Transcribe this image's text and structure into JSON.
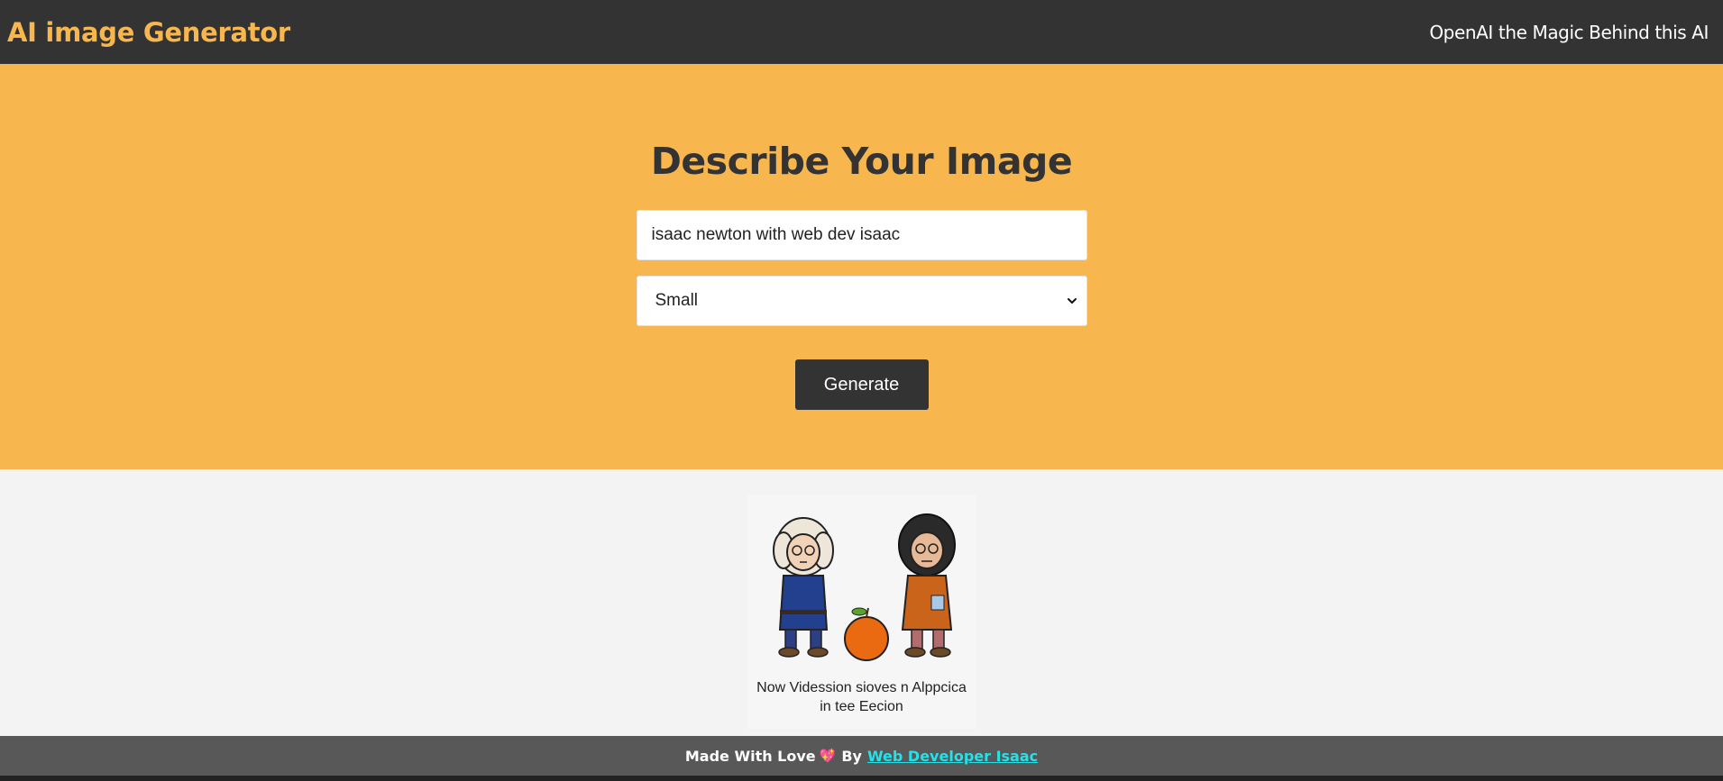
{
  "nav": {
    "logo": "AI image Generator",
    "tagline": "OpenAI the Magic Behind this AI"
  },
  "form": {
    "title": "Describe Your Image",
    "prompt_value": "isaac newton with web dev isaac",
    "size_selected": "Small",
    "generate_label": "Generate"
  },
  "result": {
    "caption_line1": "Now Vidession sioves n Alppcica",
    "caption_line2": "in tee Eecion"
  },
  "footer": {
    "made_with": "Made With Love",
    "heart": "💖",
    "by": "By",
    "author_link": "Web Developer Isaac"
  },
  "colors": {
    "accent": "#f8b74e",
    "dark": "#333333",
    "link": "#22e3ea"
  }
}
